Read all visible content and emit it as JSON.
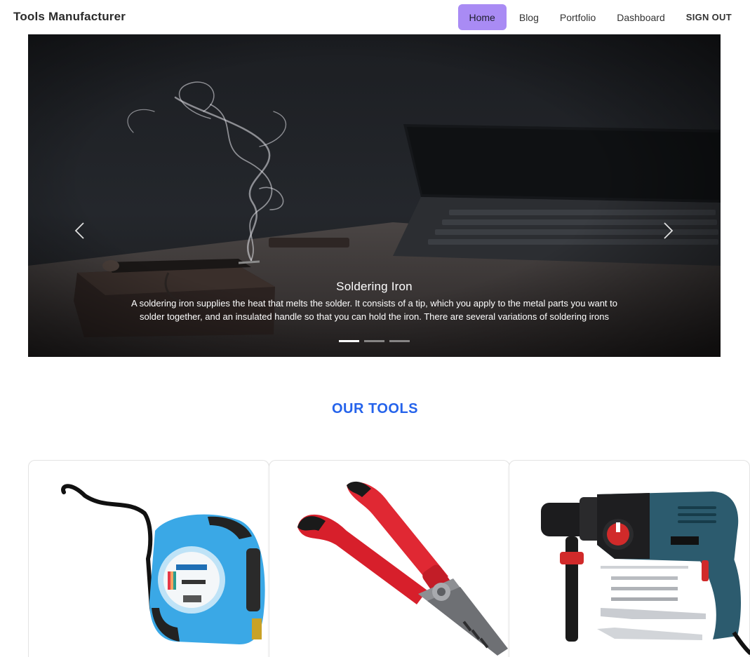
{
  "navbar": {
    "brand": "Tools Manufacturer",
    "links": [
      {
        "label": "Home",
        "active": true
      },
      {
        "label": "Blog",
        "active": false
      },
      {
        "label": "Portfolio",
        "active": false
      },
      {
        "label": "Dashboard",
        "active": false
      },
      {
        "label": "SIGN OUT",
        "active": false
      }
    ]
  },
  "carousel": {
    "slide_title": "Soldering Iron",
    "slide_text": "A soldering iron supplies the heat that melts the solder. It consists of a tip, which you apply to the metal parts you want to solder together, and an insulated handle so that you can hold the iron. There are several variations of soldering irons",
    "prev_icon": "chevron-left-icon",
    "next_icon": "chevron-right-icon",
    "slide_count": 3,
    "active_slide": 1
  },
  "tools_section": {
    "title": "OUR TOOLS",
    "cards": [
      {
        "image": "measuring-tape-image"
      },
      {
        "image": "pliers-image"
      },
      {
        "image": "hammer-drill-image"
      }
    ]
  },
  "colors": {
    "accent_active": "#a98bf4",
    "section_title": "#2563eb"
  }
}
